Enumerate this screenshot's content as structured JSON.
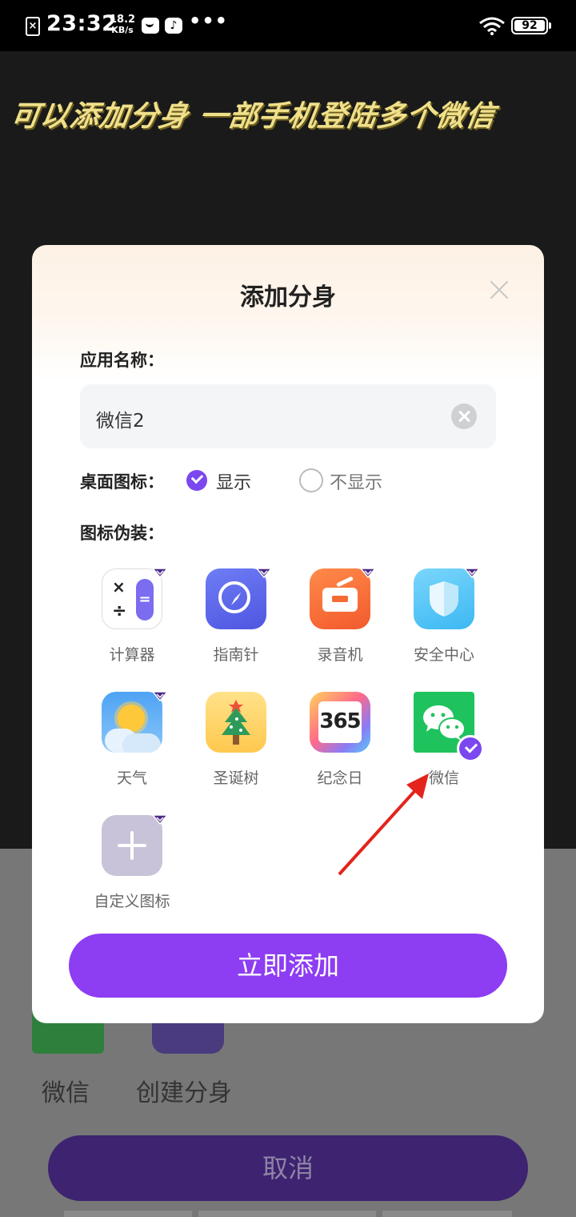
{
  "status_bar": {
    "time": "23:32",
    "net_speed_value": "18.2",
    "net_speed_unit": "KB/s",
    "more": "•••",
    "battery": "92"
  },
  "background": {
    "caption": "可以添加分身 一部手机登陆多个微信",
    "wechat_label": "微信",
    "create_label": "创建分身",
    "cancel_label": "取消"
  },
  "dialog": {
    "title": "添加分身",
    "app_name_label": "应用名称：",
    "app_name_value": "微信2",
    "desktop_icon_label": "桌面图标：",
    "show_option": "显示",
    "hide_option": "不显示",
    "show_selected": true,
    "disguise_label": "图标伪装：",
    "icons": [
      {
        "label": "计算器",
        "icon": "calculator-icon",
        "selected": false
      },
      {
        "label": "指南针",
        "icon": "compass-icon",
        "selected": false
      },
      {
        "label": "录音机",
        "icon": "recorder-icon",
        "selected": false
      },
      {
        "label": "安全中心",
        "icon": "shield-icon",
        "selected": false
      },
      {
        "label": "天气",
        "icon": "weather-icon",
        "selected": false
      },
      {
        "label": "圣诞树",
        "icon": "christmas-tree-icon",
        "selected": false
      },
      {
        "label": "纪念日",
        "icon": "anniversary-icon",
        "selected": false
      },
      {
        "label": "微信",
        "icon": "wechat-icon",
        "selected": true
      },
      {
        "label": "自定义图标",
        "icon": "plus-icon",
        "selected": false
      }
    ],
    "anniversary_number": "365",
    "add_button": "立即添加"
  },
  "colors": {
    "accent": "#7b47ee",
    "button": "#8d3df2",
    "annotation_arrow": "#e3231c"
  }
}
